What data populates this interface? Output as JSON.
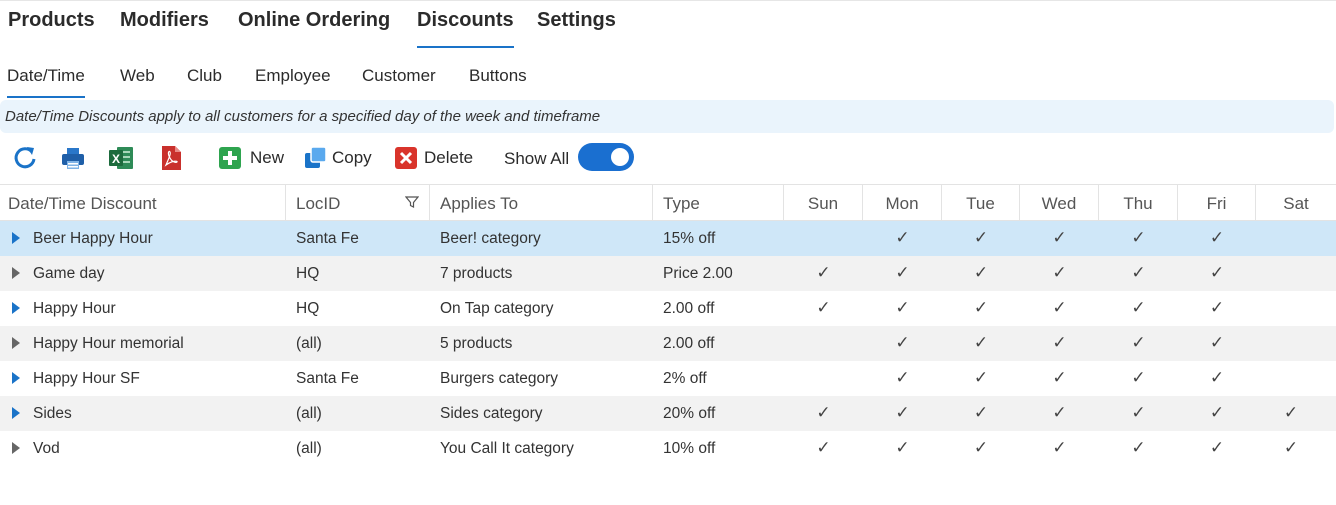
{
  "top_nav": [
    {
      "label": "Products",
      "active": false
    },
    {
      "label": "Modifiers",
      "active": false
    },
    {
      "label": "Online Ordering",
      "active": false
    },
    {
      "label": "Discounts",
      "active": true
    },
    {
      "label": "Settings",
      "active": false
    }
  ],
  "sub_nav": [
    {
      "label": "Date/Time",
      "active": true
    },
    {
      "label": "Web",
      "active": false
    },
    {
      "label": "Club",
      "active": false
    },
    {
      "label": "Employee",
      "active": false
    },
    {
      "label": "Customer",
      "active": false
    },
    {
      "label": "Buttons",
      "active": false
    }
  ],
  "info_text": "Date/Time Discounts apply to all customers for a specified day of the week and timeframe",
  "toolbar": {
    "refresh_icon": "refresh-icon",
    "print_icon": "printer-icon",
    "excel_icon": "excel-icon",
    "pdf_icon": "pdf-icon",
    "new_label": "New",
    "copy_label": "Copy",
    "delete_label": "Delete",
    "show_all_label": "Show All",
    "show_all_on": true
  },
  "colors": {
    "accent": "#1a73c8",
    "selected_row": "#cfe7f8",
    "alt_row": "#f2f2f2",
    "toggle": "#1a6fd0"
  },
  "table": {
    "columns": [
      "Date/Time Discount",
      "LocID",
      "Applies To",
      "Type",
      "Sun",
      "Mon",
      "Tue",
      "Wed",
      "Thu",
      "Fri",
      "Sat"
    ],
    "check_glyph": "✓",
    "rows": [
      {
        "name": "Beer Happy Hour",
        "loc": "Santa Fe",
        "applies": "Beer! category",
        "type": "15% off",
        "days": [
          false,
          true,
          true,
          true,
          true,
          true,
          false
        ],
        "arrow": "blue",
        "selected": true
      },
      {
        "name": "Game day",
        "loc": "HQ",
        "applies": "7 products",
        "type": "Price 2.00",
        "days": [
          true,
          true,
          true,
          true,
          true,
          true,
          false
        ],
        "arrow": "gray",
        "selected": false
      },
      {
        "name": "Happy Hour",
        "loc": "HQ",
        "applies": "On Tap category",
        "type": "2.00 off",
        "days": [
          true,
          true,
          true,
          true,
          true,
          true,
          false
        ],
        "arrow": "blue",
        "selected": false
      },
      {
        "name": "Happy Hour memorial",
        "loc": "(all)",
        "applies": "5 products",
        "type": "2.00 off",
        "days": [
          false,
          true,
          true,
          true,
          true,
          true,
          false
        ],
        "arrow": "gray",
        "selected": false
      },
      {
        "name": "Happy Hour SF",
        "loc": "Santa Fe",
        "applies": "Burgers category",
        "type": "2% off",
        "days": [
          false,
          true,
          true,
          true,
          true,
          true,
          false
        ],
        "arrow": "blue",
        "selected": false
      },
      {
        "name": "Sides",
        "loc": "(all)",
        "applies": "Sides category",
        "type": "20% off",
        "days": [
          true,
          true,
          true,
          true,
          true,
          true,
          true
        ],
        "arrow": "blue",
        "selected": false
      },
      {
        "name": "Vod",
        "loc": "(all)",
        "applies": "You Call It category",
        "type": "10% off",
        "days": [
          true,
          true,
          true,
          true,
          true,
          true,
          true
        ],
        "arrow": "gray",
        "selected": false
      }
    ]
  }
}
